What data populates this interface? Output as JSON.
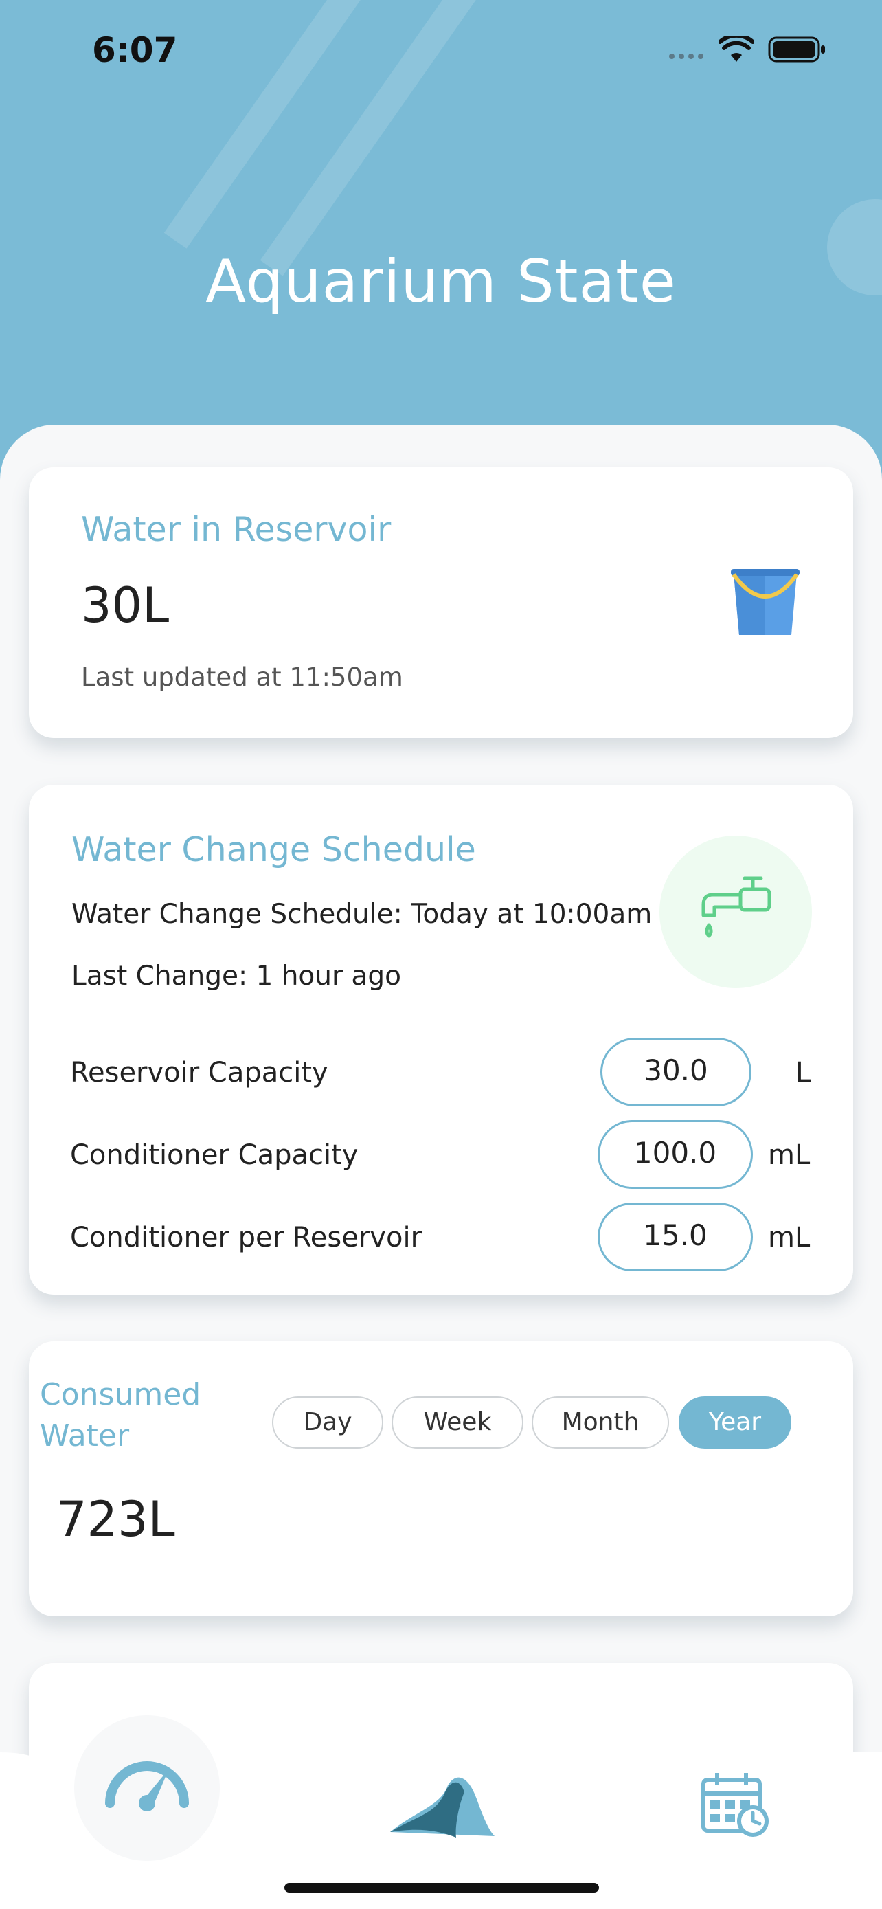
{
  "status_bar": {
    "time": "6:07"
  },
  "header": {
    "title": "Aquarium State"
  },
  "reservoir_card": {
    "title": "Water in Reservoir",
    "value": "30L",
    "updated": "Last updated at 11:50am",
    "icon": "bucket-icon"
  },
  "schedule_card": {
    "title": "Water Change Schedule",
    "schedule_line": "Water Change Schedule: Today at 10:00am",
    "last_change": "Last Change: 1 hour ago",
    "icon": "faucet-icon",
    "fields": [
      {
        "label": "Reservoir Capacity",
        "value": "30.0",
        "unit": "L"
      },
      {
        "label": "Conditioner Capacity",
        "value": "100.0",
        "unit": "mL"
      },
      {
        "label": "Conditioner per Reservoir",
        "value": "15.0",
        "unit": "mL"
      }
    ]
  },
  "consumed_card": {
    "title_line1": "Consumed",
    "title_line2": "Water",
    "periods": [
      "Day",
      "Week",
      "Month",
      "Year"
    ],
    "selected_period": "Year",
    "value": "723L"
  },
  "bottom_nav": {
    "items": [
      "dashboard-gauge-icon",
      "aquarium-wave-icon",
      "calendar-schedule-icon"
    ],
    "active": "dashboard-gauge-icon"
  },
  "colors": {
    "header_bg": "#7bbbd6",
    "accent": "#74b7d2",
    "tap_green": "#5fcf8a"
  }
}
